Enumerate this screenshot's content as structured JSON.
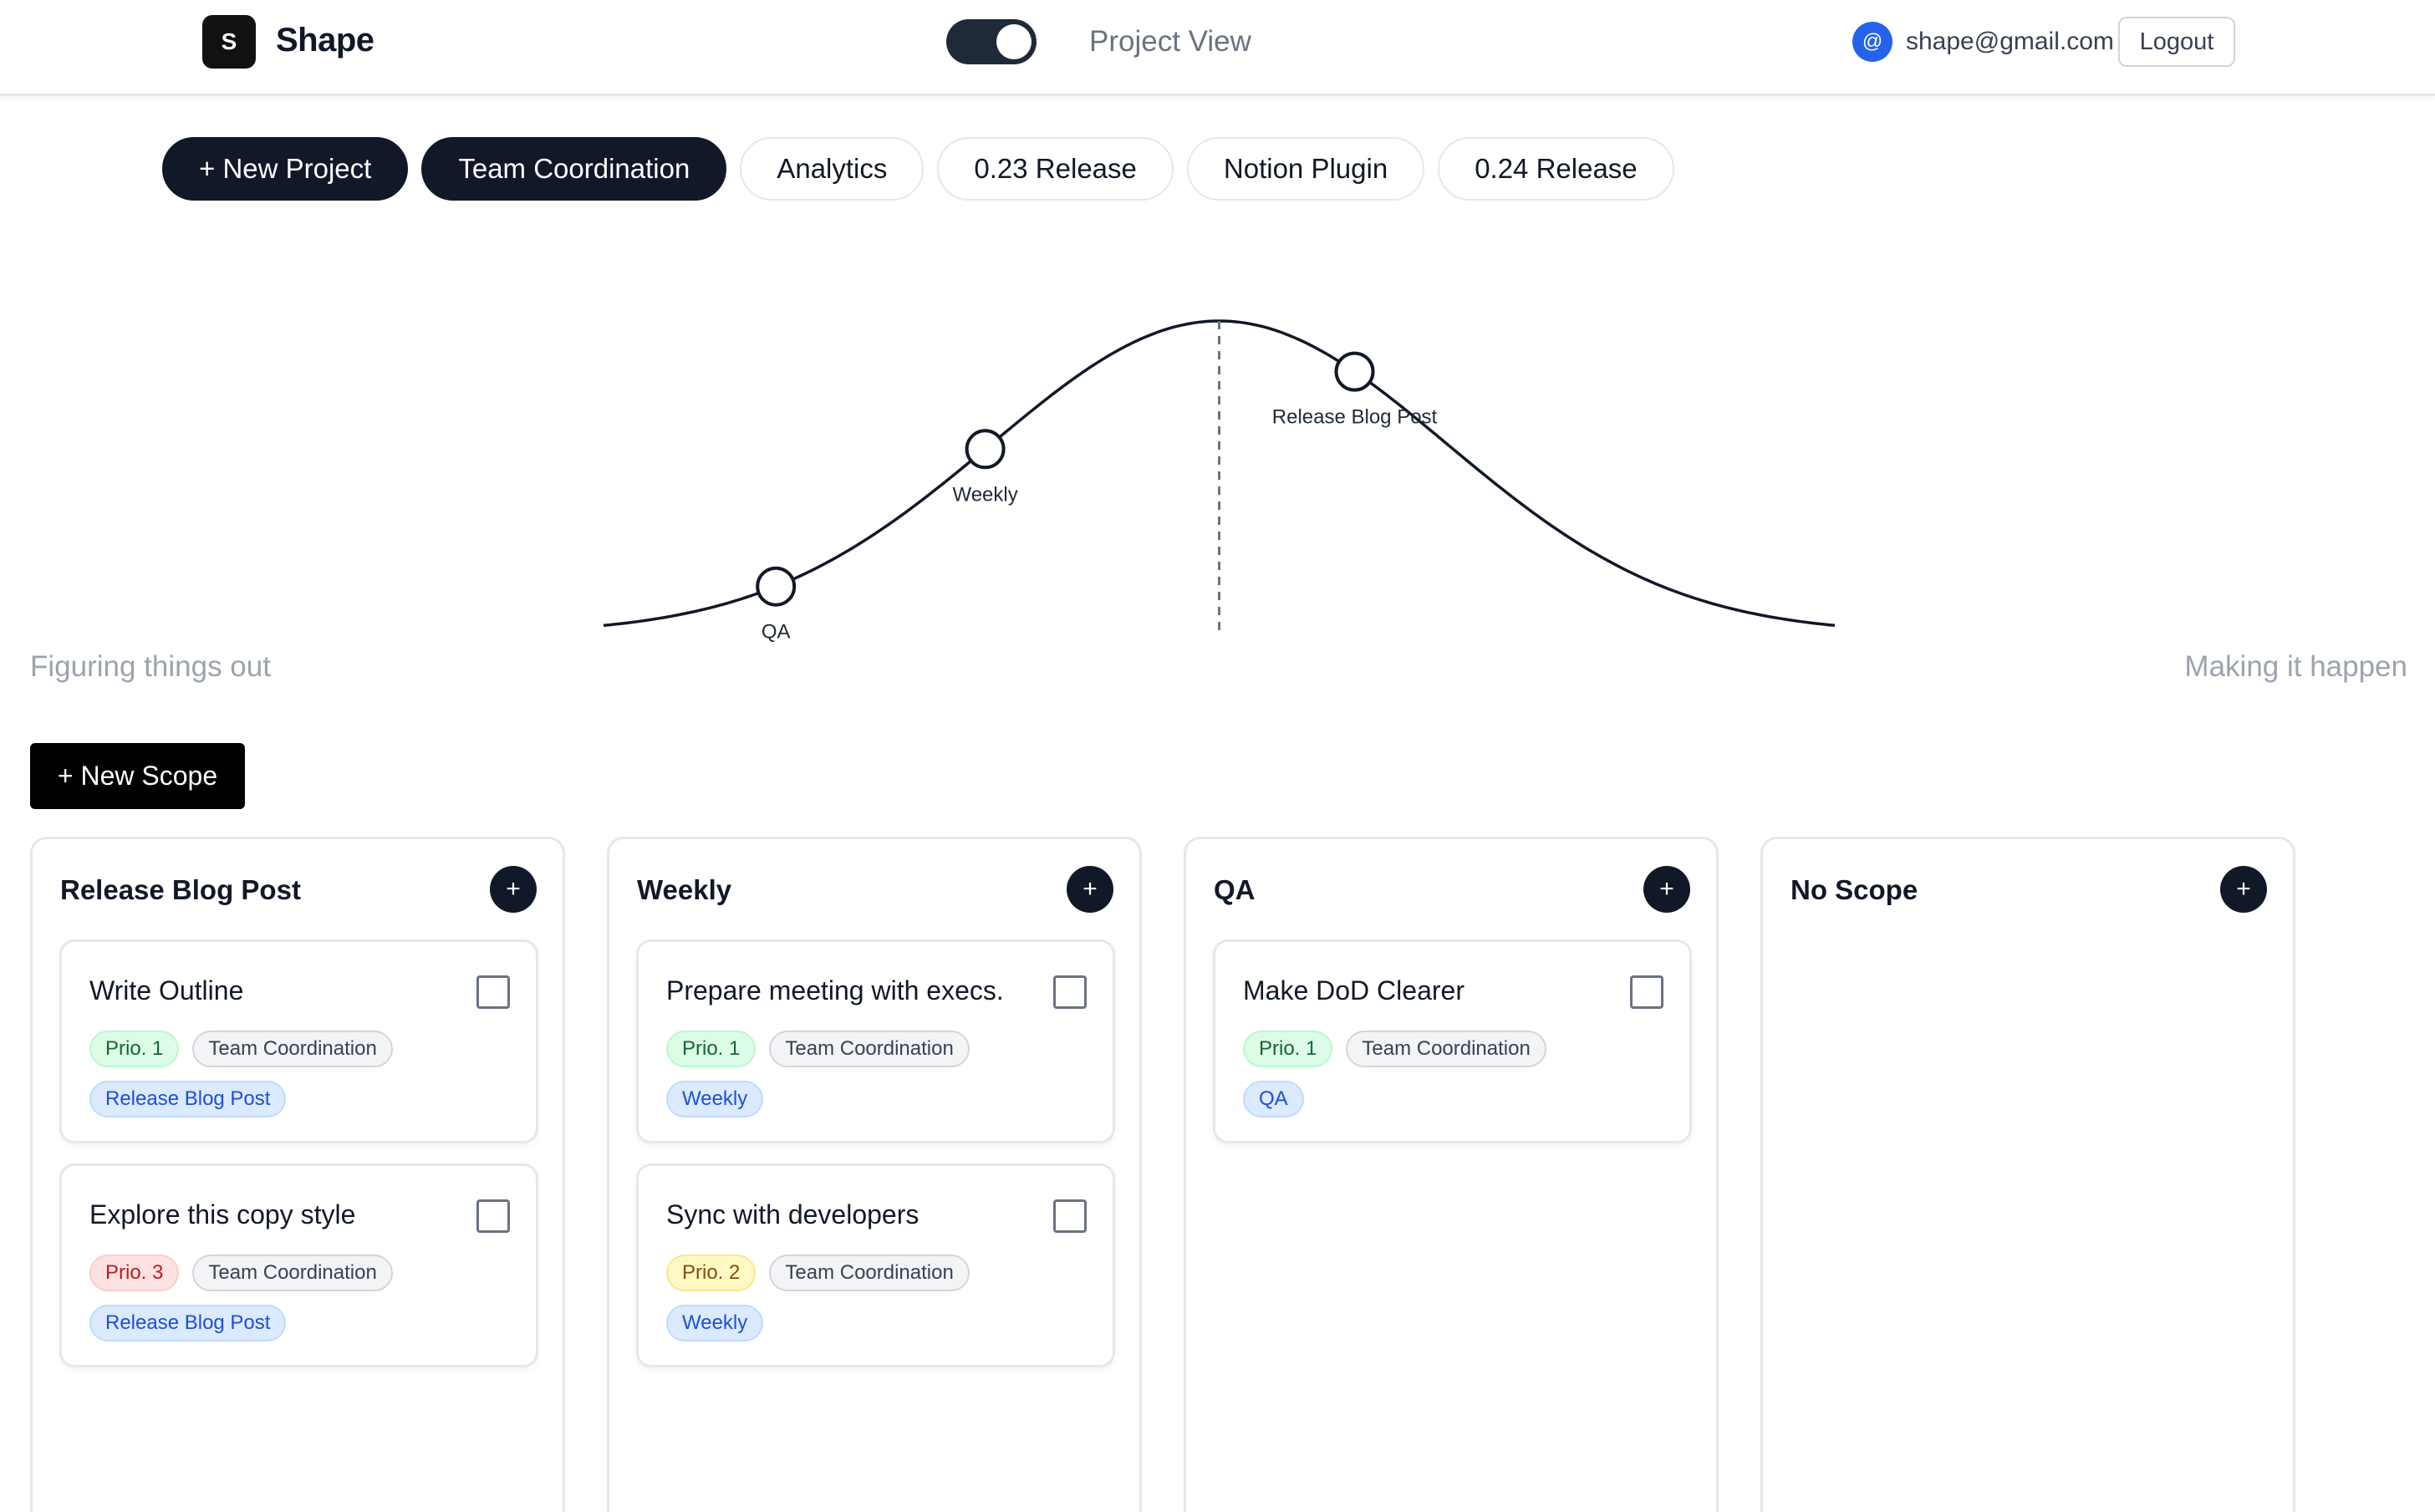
{
  "header": {
    "logo_letter": "S",
    "brand": "Shape",
    "view_toggle_on": true,
    "view_label": "Project View",
    "email_icon_glyph": "@",
    "email": "shape@gmail.com",
    "logout_label": "Logout"
  },
  "projects": {
    "new_label": "+ New Project",
    "tabs": [
      {
        "label": "Team Coordination",
        "active": true
      },
      {
        "label": "Analytics",
        "active": false
      },
      {
        "label": "0.23 Release",
        "active": false
      },
      {
        "label": "Notion Plugin",
        "active": false
      },
      {
        "label": "0.24 Release",
        "active": false
      }
    ]
  },
  "hill": {
    "left_label": "Figuring things out",
    "right_label": "Making it happen",
    "points": [
      {
        "label": "QA",
        "progress": 0.14
      },
      {
        "label": "Weekly",
        "progress": 0.31
      },
      {
        "label": "Release Blog Post",
        "progress": 0.61
      }
    ]
  },
  "new_scope_label": "+ New Scope",
  "add_glyph": "+",
  "columns": [
    {
      "title": "Release Blog Post",
      "cards": [
        {
          "title": "Write Outline",
          "prio": "Prio. 1",
          "prio_color": "green",
          "project": "Team Coordination",
          "scope": "Release Blog Post"
        },
        {
          "title": "Explore this copy style",
          "prio": "Prio. 3",
          "prio_color": "red",
          "project": "Team Coordination",
          "scope": "Release Blog Post"
        }
      ]
    },
    {
      "title": "Weekly",
      "cards": [
        {
          "title": "Prepare meeting with execs.",
          "prio": "Prio. 1",
          "prio_color": "green",
          "project": "Team Coordination",
          "scope": "Weekly"
        },
        {
          "title": "Sync with developers",
          "prio": "Prio. 2",
          "prio_color": "yellow",
          "project": "Team Coordination",
          "scope": "Weekly"
        }
      ]
    },
    {
      "title": "QA",
      "cards": [
        {
          "title": "Make DoD Clearer",
          "prio": "Prio. 1",
          "prio_color": "green",
          "project": "Team Coordination",
          "scope": "QA"
        }
      ]
    },
    {
      "title": "No Scope",
      "cards": []
    }
  ]
}
